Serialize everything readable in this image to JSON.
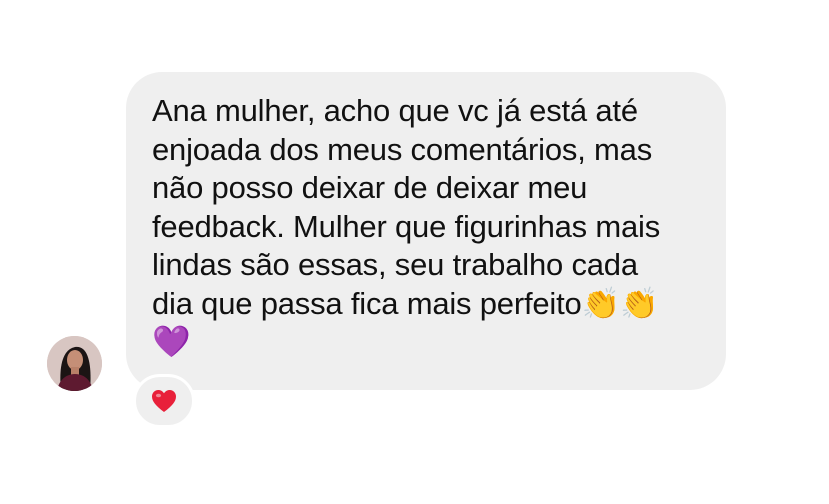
{
  "message": {
    "text": "Ana mulher, acho que vc já está até\nenjoada dos meus comentários, mas\nnão posso deixar de deixar meu\nfeedback. Mulher que figurinhas mais\nlindas são essas, seu trabalho cada\ndia que passa fica mais perfeito👏👏\n💜"
  },
  "avatar": {
    "icon": "user-avatar"
  },
  "reaction": {
    "icon": "red-heart-icon",
    "color": "#e8203a"
  },
  "colors": {
    "bubble_background": "#efefef",
    "text": "#111111",
    "page_background": "#ffffff"
  }
}
